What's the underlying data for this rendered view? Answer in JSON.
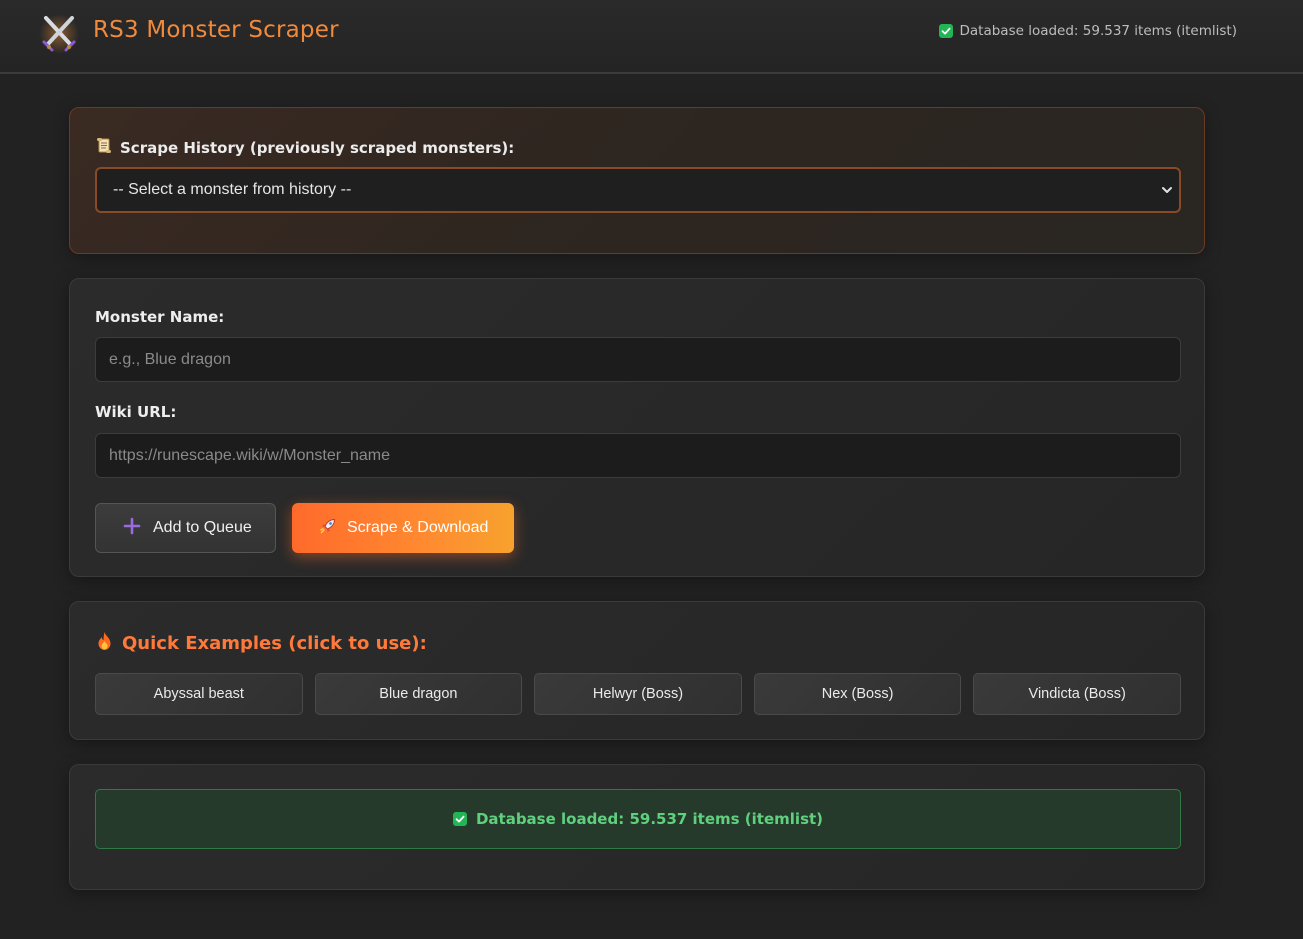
{
  "header": {
    "title": "RS3 Monster Scraper",
    "status": "Database loaded: 59.537 items (itemlist)",
    "logo_icon": "crossed-swords-icon"
  },
  "history": {
    "label": "Scrape History (previously scraped monsters):",
    "selected_option": "-- Select a monster from history --"
  },
  "form": {
    "monster_name_label": "Monster Name:",
    "monster_name_value": "",
    "monster_name_placeholder": "e.g., Blue dragon",
    "wiki_url_label": "Wiki URL:",
    "wiki_url_value": "",
    "wiki_url_placeholder": "https://runescape.wiki/w/Monster_name",
    "add_queue_label": "Add to Queue",
    "scrape_label": "Scrape & Download"
  },
  "examples": {
    "title": "Quick Examples (click to use):",
    "items": [
      "Abyssal beast",
      "Blue dragon",
      "Helwyr (Boss)",
      "Nex (Boss)",
      "Vindicta (Boss)"
    ]
  },
  "status": {
    "message": "Database loaded: 59.537 items (itemlist)"
  },
  "colors": {
    "accent": "#f08a3c",
    "success": "#22b556",
    "scrape_button": "#ff7a2e"
  }
}
